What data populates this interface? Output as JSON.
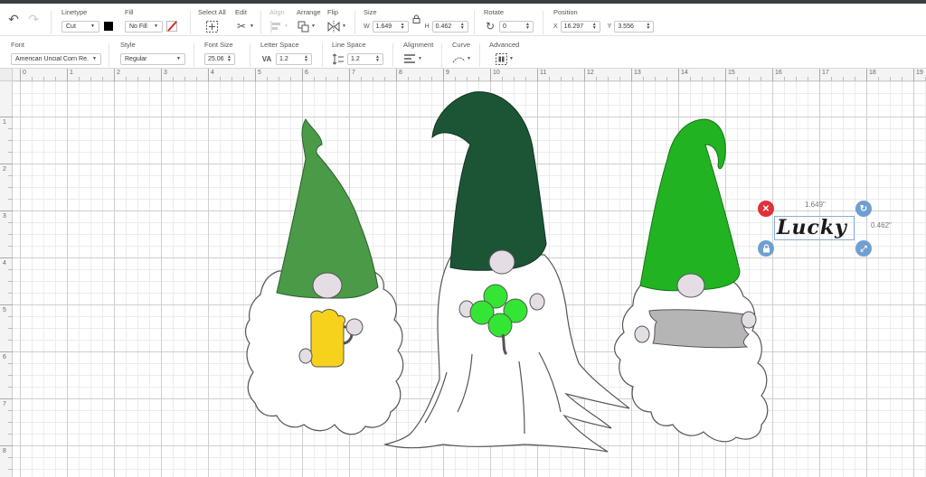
{
  "toolbar1": {
    "linetype": {
      "label": "Linetype",
      "value": "Cut"
    },
    "fill": {
      "label": "Fill",
      "value": "No Fill"
    },
    "select_all": {
      "label": "Select All"
    },
    "edit": {
      "label": "Edit"
    },
    "align": {
      "label": "Align"
    },
    "arrange": {
      "label": "Arrange"
    },
    "flip": {
      "label": "Flip"
    },
    "size": {
      "label": "Size",
      "w_label": "W",
      "w_value": "1.649",
      "h_label": "H",
      "h_value": "0.462"
    },
    "rotate": {
      "label": "Rotate",
      "value": "0"
    },
    "position": {
      "label": "Position",
      "x_label": "X",
      "x_value": "16.297",
      "y_label": "Y",
      "y_value": "3.556"
    }
  },
  "toolbar2": {
    "font": {
      "label": "Font",
      "value": "American Uncial Corn Re..."
    },
    "style": {
      "label": "Style",
      "value": "Regular"
    },
    "font_size": {
      "label": "Font Size",
      "value": "25.06"
    },
    "letter_space": {
      "label": "Letter Space",
      "value": "1.2"
    },
    "line_space": {
      "label": "Line Space",
      "value": "1.2"
    },
    "alignment": {
      "label": "Alignment"
    },
    "curve": {
      "label": "Curve"
    },
    "advanced": {
      "label": "Advanced"
    }
  },
  "ruler": {
    "top": [
      "0",
      "1",
      "2",
      "3",
      "4",
      "5",
      "6",
      "7",
      "8",
      "9",
      "10",
      "11",
      "12",
      "13",
      "14",
      "15",
      "16",
      "17",
      "18",
      "19"
    ],
    "left": [
      "1",
      "2",
      "3",
      "4",
      "5",
      "6",
      "7",
      "8"
    ]
  },
  "selection": {
    "text": "Lucky",
    "width_label": "1.649\"",
    "height_label": "0.462\""
  },
  "colors": {
    "hat_left": "#4a9a48",
    "hat_center": "#1c5535",
    "hat_right": "#22b322",
    "shamrock": "#33e633",
    "mug": "#f7d21c",
    "sign": "#b5b5b5",
    "nose": "#e4dde4",
    "handle_close": "#e0303a",
    "handle_blue": "#6f9fd0"
  }
}
